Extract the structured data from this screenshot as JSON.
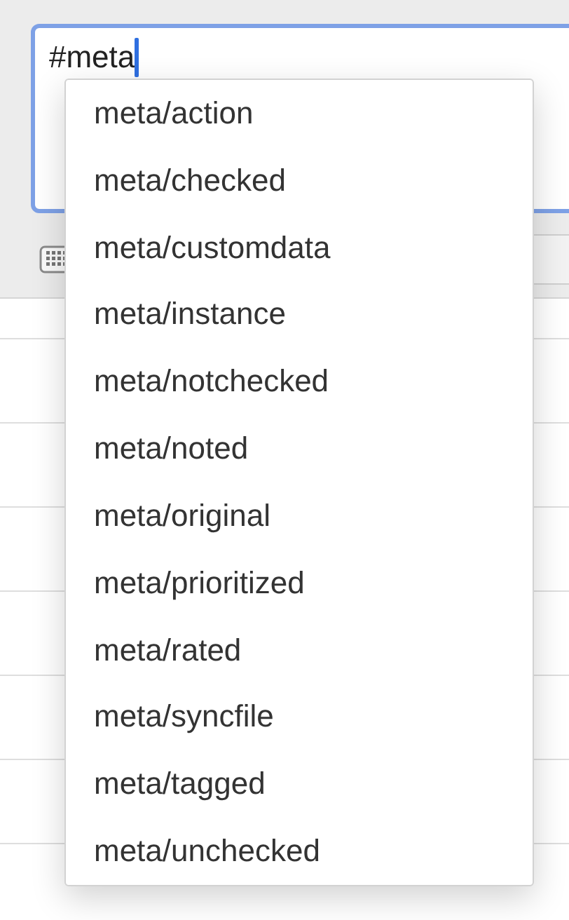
{
  "query_field": {
    "value": "#meta"
  },
  "suggestions": [
    {
      "label": "meta/action",
      "selected": false
    },
    {
      "label": "meta/checked",
      "selected": false
    },
    {
      "label": "meta/customdata",
      "selected": false
    },
    {
      "label": "meta/instance",
      "selected": false
    },
    {
      "label": "meta/notchecked",
      "selected": false
    },
    {
      "label": "meta/noted",
      "selected": false
    },
    {
      "label": "meta/original",
      "selected": false
    },
    {
      "label": "meta/prioritized",
      "selected": false
    },
    {
      "label": "meta/rated",
      "selected": false
    },
    {
      "label": "meta/syncfile",
      "selected": false
    },
    {
      "label": "meta/tagged",
      "selected": false
    },
    {
      "label": "meta/unchecked",
      "selected": false
    }
  ]
}
